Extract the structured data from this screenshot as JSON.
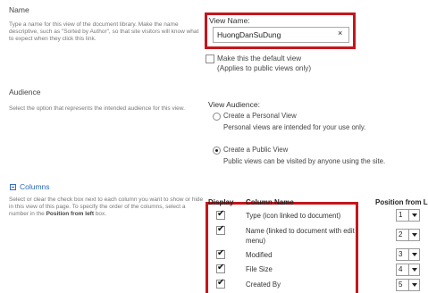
{
  "name_section": {
    "title": "Name",
    "description": "Type a name for this view of the document library. Make the name descriptive, such as \"Sorted by Author\", so that site visitors will know what to expect when they click this link.",
    "view_name_label": "View Name:",
    "view_name_value": "HuongDanSuDung",
    "clear_glyph": "×",
    "default_view_label": "Make this the default view",
    "default_view_note": "(Applies to public views only)",
    "default_view_checked": false
  },
  "audience_section": {
    "title": "Audience",
    "description": "Select the option that represents the intended audience for this view.",
    "view_audience_label": "View Audience:",
    "options": [
      {
        "label": "Create a Personal View",
        "note": "Personal views are intended for your use only.",
        "selected": false
      },
      {
        "label": "Create a Public View",
        "note": "Public views can be visited by anyone using the site.",
        "selected": true
      }
    ]
  },
  "columns_section": {
    "title": "Columns",
    "description_part1": "Select or clear the check box next to each column you want to show or hide in this view of this page. To specify the order of the columns, select a number in the ",
    "description_bold": "Position from left",
    "description_part2": " box.",
    "headers": {
      "display": "Display",
      "column_name": "Column Name",
      "position": "Position from Left"
    },
    "rows": [
      {
        "name": "Type (icon linked to document)",
        "checked": true,
        "position": "1"
      },
      {
        "name": "Name (linked to document with edit menu)",
        "checked": true,
        "position": "2"
      },
      {
        "name": "Modified",
        "checked": true,
        "position": "3"
      },
      {
        "name": "File Size",
        "checked": true,
        "position": "4"
      },
      {
        "name": "Created By",
        "checked": true,
        "position": "5"
      }
    ]
  },
  "colors": {
    "highlight_box": "#c4161c",
    "link": "#2a6ab8"
  },
  "icons": {
    "columns_toggle": "collapse-minus-icon",
    "dropdown": "chevron-down-icon"
  }
}
